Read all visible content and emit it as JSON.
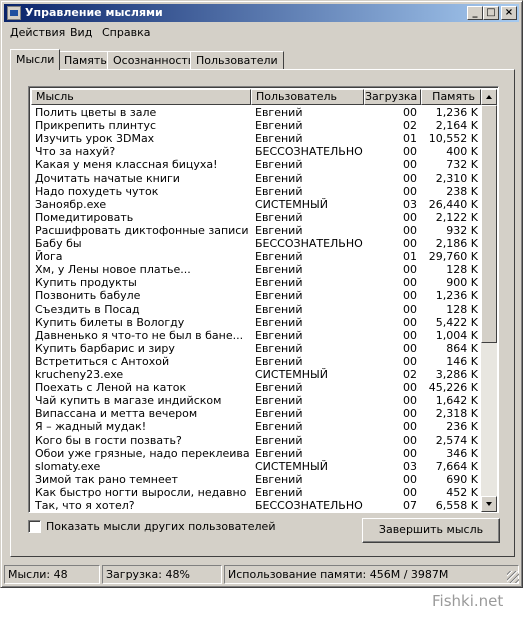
{
  "window": {
    "title": "Управление мыслями",
    "buttons": {
      "minimize": "_",
      "maximize": "□",
      "close": "×"
    }
  },
  "menu": [
    "Действия",
    "Вид",
    "Справка"
  ],
  "tabs": [
    {
      "label": "Мысли",
      "active": true
    },
    {
      "label": "Память",
      "active": false
    },
    {
      "label": "Осознанность",
      "active": false
    },
    {
      "label": "Пользователи",
      "active": false
    }
  ],
  "table": {
    "columns": [
      "Мысль",
      "Пользователь",
      "Загрузка",
      "Память"
    ],
    "rows": [
      [
        "Полить цветы в зале",
        "Евгений",
        "00",
        "1,236 K"
      ],
      [
        "Прикрепить плинтус",
        "Евгений",
        "02",
        "2,164 K"
      ],
      [
        "Изучить урок 3DMax",
        "Евгений",
        "01",
        "10,552 K"
      ],
      [
        "Что за нахуй?",
        "БЕССОЗНАТЕЛЬНОЕ",
        "00",
        "400 K"
      ],
      [
        "Какая у меня классная бицуха!",
        "Евгений",
        "00",
        "732 K"
      ],
      [
        "Дочитать начатые книги",
        "Евгений",
        "00",
        "2,310 K"
      ],
      [
        "Надо похудеть чуток",
        "Евгений",
        "00",
        "238 K"
      ],
      [
        "Заноябр.exe",
        "СИСТЕМНЫЙ",
        "03",
        "26,440 K"
      ],
      [
        "Помедитировать",
        "Евгений",
        "00",
        "2,122 K"
      ],
      [
        "Расшифровать диктофонные записи",
        "Евгений",
        "00",
        "932 K"
      ],
      [
        "Бабу бы",
        "БЕССОЗНАТЕЛЬНОЕ",
        "00",
        "2,186 K"
      ],
      [
        "Йога",
        "Евгений",
        "01",
        "29,760 K"
      ],
      [
        "Хм, у Лены новое платье...",
        "Евгений",
        "00",
        "128 K"
      ],
      [
        "Купить продукты",
        "Евгений",
        "00",
        "900 K"
      ],
      [
        "Позвонить бабуле",
        "Евгений",
        "00",
        "1,236 K"
      ],
      [
        "Съездить в Посад",
        "Евгений",
        "00",
        "128 K"
      ],
      [
        "Купить билеты в Вологду",
        "Евгений",
        "00",
        "5,422 K"
      ],
      [
        "Давненько я что-то не был в бане...",
        "Евгений",
        "00",
        "1,004 K"
      ],
      [
        "Купить барбарис и зиру",
        "Евгений",
        "00",
        "864 K"
      ],
      [
        "Встретиться с Антохой",
        "Евгений",
        "00",
        "146 K"
      ],
      [
        "krucheny23.exe",
        "СИСТЕМНЫЙ",
        "02",
        "3,286 K"
      ],
      [
        "Поехать с Леной на каток",
        "Евгений",
        "00",
        "45,226 K"
      ],
      [
        "Чай купить в магазе индийском",
        "Евгений",
        "00",
        "1,642 K"
      ],
      [
        "Випассана и метта вечером",
        "Евгений",
        "00",
        "2,318 K"
      ],
      [
        "Я – жадный мудак!",
        "Евгений",
        "00",
        "236 K"
      ],
      [
        "Кого бы в гости позвать?",
        "Евгений",
        "00",
        "2,574 K"
      ],
      [
        "Обои уже грязные, надо переклеивать",
        "Евгений",
        "00",
        "346 K"
      ],
      [
        "slomaty.exe",
        "СИСТЕМНЫЙ",
        "03",
        "7,664 K"
      ],
      [
        "Зимой так рано темнеет",
        "Евгений",
        "00",
        "690 K"
      ],
      [
        "Как быстро ногти выросли, недавно же...",
        "Евгений",
        "00",
        "452 K"
      ],
      [
        "Так, что я хотел?",
        "БЕССОЗНАТЕЛЬНОЕ",
        "07",
        "6,558 K"
      ]
    ]
  },
  "checkbox": {
    "label": "Показать мысли других пользователей",
    "checked": false
  },
  "end_button": "Завершить мысль",
  "status": {
    "thoughts": "Мысли: 48",
    "load": "Загрузка: 48%",
    "memory": "Использование памяти: 456M / 3987M"
  },
  "watermark": "Fishki.net"
}
